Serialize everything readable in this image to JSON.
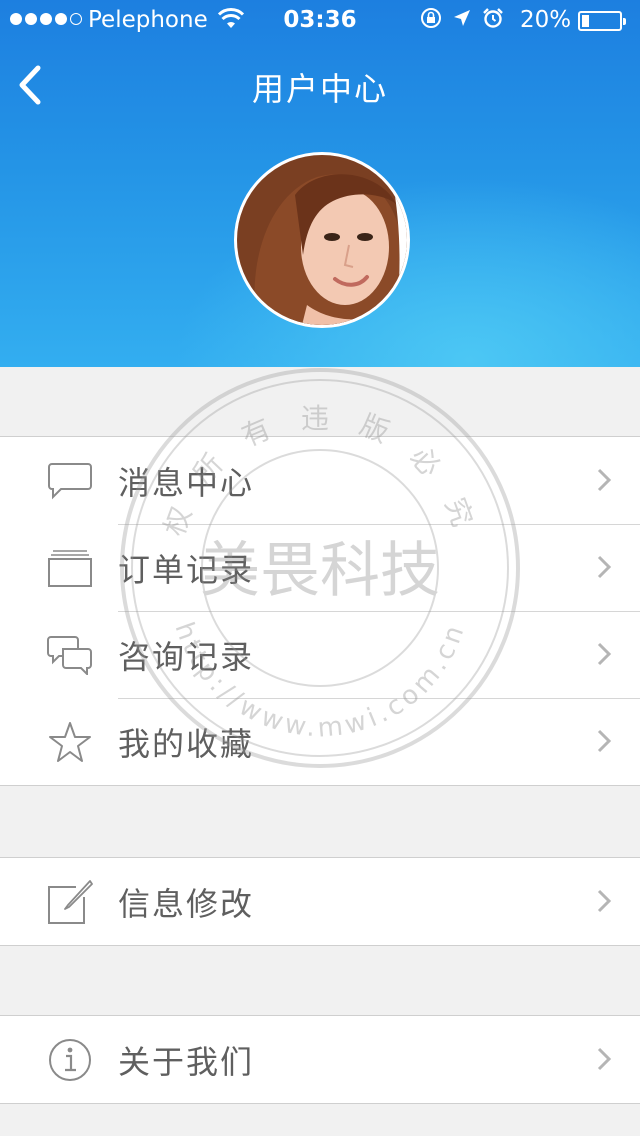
{
  "status_bar": {
    "carrier": "Pelephone",
    "time": "03:36",
    "battery_percent": "20%",
    "battery_level": 0.2
  },
  "nav": {
    "title": "用户中心"
  },
  "menu_group_1": [
    {
      "label": "消息中心",
      "icon": "message-icon"
    },
    {
      "label": "订单记录",
      "icon": "folder-icon"
    },
    {
      "label": "咨询记录",
      "icon": "chat-bubbles-icon"
    },
    {
      "label": "我的收藏",
      "icon": "star-icon"
    }
  ],
  "menu_group_2": [
    {
      "label": "信息修改",
      "icon": "edit-icon"
    }
  ],
  "menu_group_3": [
    {
      "label": "关于我们",
      "icon": "info-icon"
    }
  ],
  "watermark": {
    "top_text": "权 所 有 违 版 必 究",
    "center_text": "美畏科技",
    "bottom_text": "http://www.mwi.com.cn"
  },
  "colors": {
    "header_top": "#1d7fe0",
    "header_bottom": "#33aef0",
    "label_text": "#5f5f5f",
    "icon_gray": "#8a8a8a"
  }
}
